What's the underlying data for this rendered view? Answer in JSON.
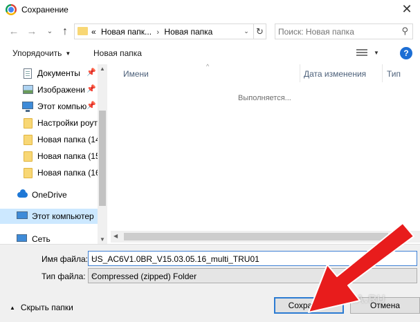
{
  "window": {
    "title": "Сохранение",
    "close_glyph": "✕"
  },
  "nav": {
    "back_glyph": "←",
    "forward_glyph": "→",
    "recent_glyph": "⌄",
    "up_glyph": "↑",
    "breadcrumb_prefix": "«",
    "breadcrumbs": [
      "Новая папк...",
      "Новая папка"
    ],
    "breadcrumb_sep": "›",
    "dropdown_glyph": "⌄",
    "refresh_glyph": "↻",
    "search_placeholder": "Поиск: Новая папка",
    "search_glyph": "⚲"
  },
  "toolbar": {
    "organize_label": "Упорядочить",
    "organize_caret": "▼",
    "new_folder_label": "Новая папка",
    "view_caret": "▼",
    "help_label": "?"
  },
  "sidebar": {
    "pin_glyph": "📌",
    "items": [
      {
        "label": "Документы",
        "icon": "document-icon",
        "pinned": true
      },
      {
        "label": "Изображени",
        "icon": "pictures-icon",
        "pinned": true
      },
      {
        "label": "Этот компью",
        "icon": "computer-icon",
        "pinned": true
      },
      {
        "label": "Настройки роут",
        "icon": "folder-icon",
        "pinned": false
      },
      {
        "label": "Новая папка (14",
        "icon": "folder-icon",
        "pinned": false
      },
      {
        "label": "Новая папка (15",
        "icon": "folder-icon",
        "pinned": false
      },
      {
        "label": "Новая папка (16",
        "icon": "folder-icon",
        "pinned": false
      },
      {
        "label": "OneDrive",
        "icon": "onedrive-icon",
        "pinned": false
      },
      {
        "label": "Этот компьютер",
        "icon": "computer-icon",
        "pinned": false,
        "selected": true
      },
      {
        "label": "Сеть",
        "icon": "network-icon",
        "pinned": false
      }
    ],
    "scroll_up_glyph": "▲",
    "scroll_down_glyph": "▼"
  },
  "filelist": {
    "columns": [
      "Имени",
      "Дата изменения",
      "Тип"
    ],
    "sort_glyph": "^",
    "status": "Выполняется...",
    "scroll_left_glyph": "◀",
    "scroll_right_glyph": "▶"
  },
  "form": {
    "filename_label": "Имя файла:",
    "filename_value": "US_AC6V1.0BR_V15.03.05.16_multi_TRU01",
    "filetype_label": "Тип файла:",
    "filetype_value": "Compressed (zipped) Folder",
    "dropdown_glyph": "⌄",
    "hide_folders_caret": "▲",
    "hide_folders_label": "Скрыть папки",
    "save_label": "Сохранить",
    "cancel_label": "Отмена"
  },
  "watermark": "WIFIKA.RU",
  "annotation_color": "#e81c1c"
}
